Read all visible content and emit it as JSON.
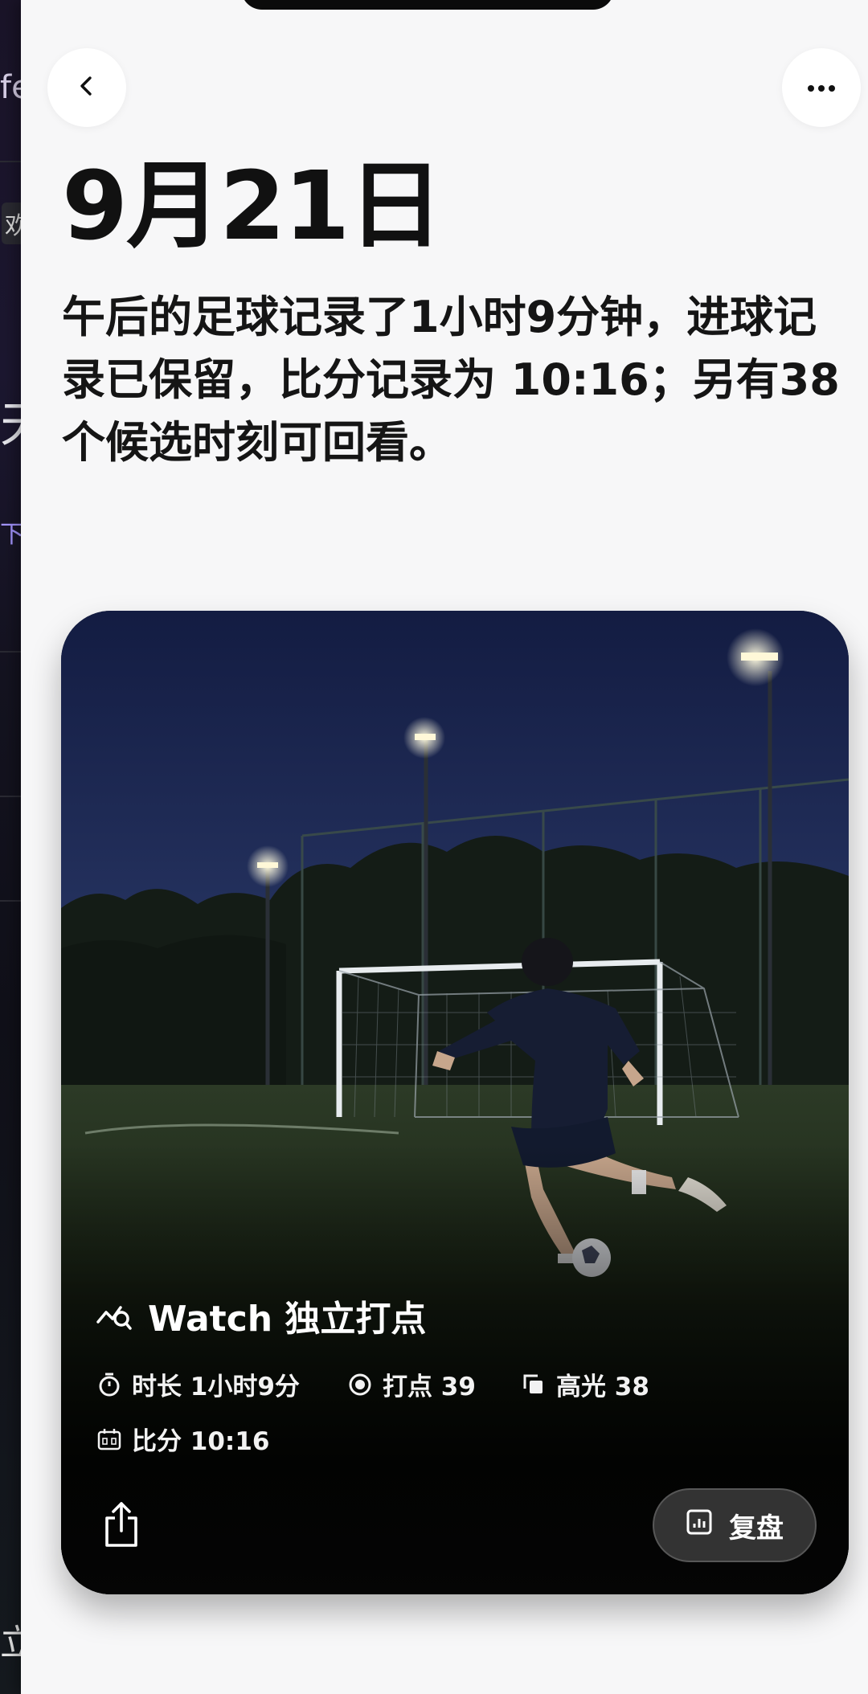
{
  "background_screen": {
    "fragments": [
      "fe",
      "欢",
      "天",
      "下边",
      "立"
    ]
  },
  "header": {
    "back_icon": "chevron-left-icon",
    "more_icon": "ellipsis-icon"
  },
  "date_title": "9月21日",
  "summary": "午后的足球记录了1小时9分钟，进球记录已保留，比分记录为 10:16；另有38 个候选时刻可回看。",
  "card": {
    "photo_icon": "soccer-night-photo",
    "source_icon": "watch-activity-icon",
    "source_label": "Watch 独立打点",
    "stats": {
      "duration": "时长 1小时9分",
      "marks": "打点 39",
      "highlights": "高光 38",
      "score": "比分 10:16"
    },
    "share_icon": "share-icon",
    "review_label": "复盘",
    "review_icon": "chart-icon"
  },
  "colors": {
    "sheet_bg": "#f7f7f8",
    "title_text": "#111111",
    "card_text": "#ffffff",
    "review_button_bg": "#3c3c3c"
  }
}
